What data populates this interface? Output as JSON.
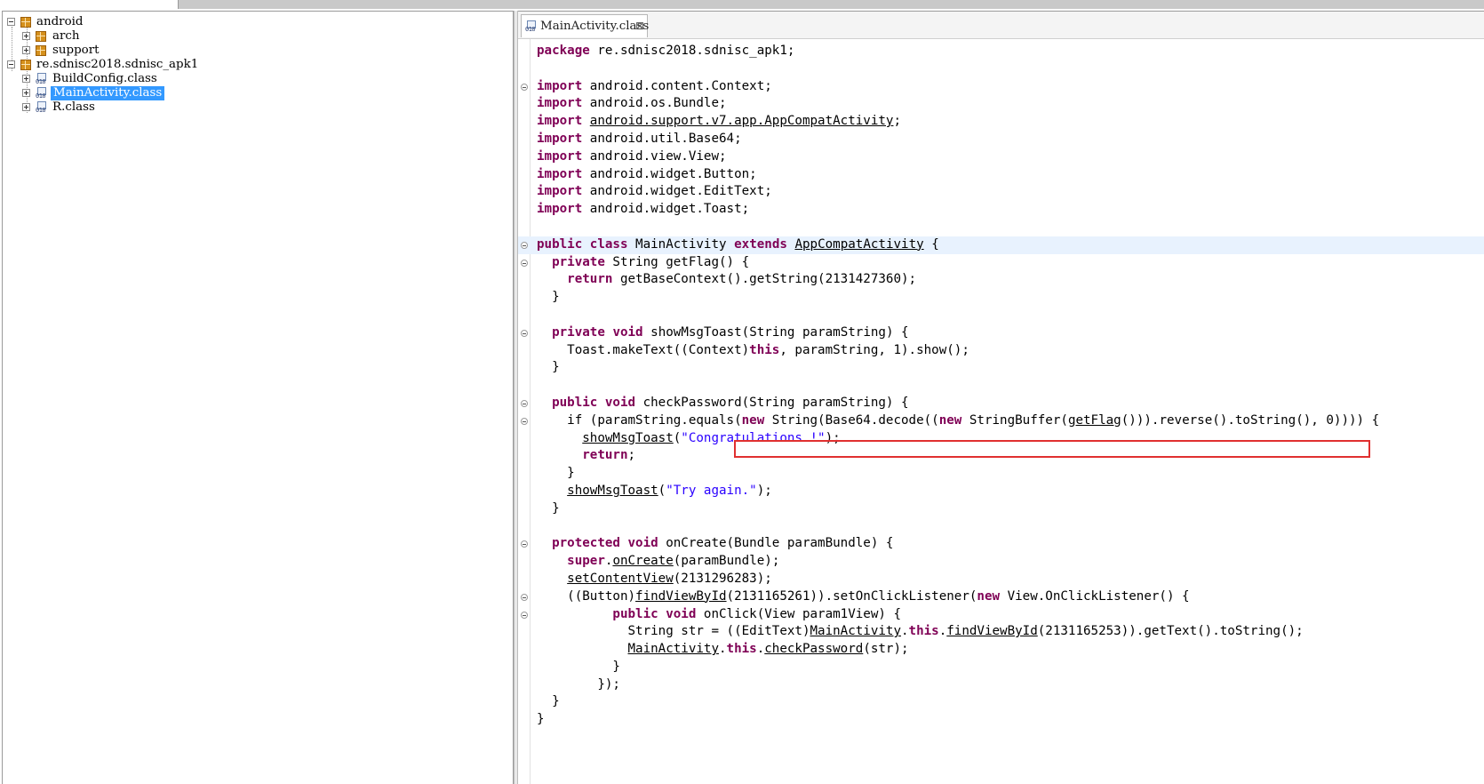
{
  "tree": {
    "items": [
      {
        "label": "android",
        "icon": "package-icon",
        "expanded": true
      },
      {
        "label": "arch",
        "icon": "package-icon",
        "expanded": false
      },
      {
        "label": "support",
        "icon": "package-icon",
        "expanded": false
      },
      {
        "label": "re.sdnisc2018.sdnisc_apk1",
        "icon": "package-icon",
        "expanded": true
      },
      {
        "label": "BuildConfig.class",
        "icon": "class-file-icon",
        "expanded": false
      },
      {
        "label": "MainActivity.class",
        "icon": "class-file-icon",
        "expanded": false,
        "selected": true
      },
      {
        "label": "R.class",
        "icon": "class-file-icon",
        "expanded": false
      }
    ]
  },
  "editor": {
    "tab_label": "MainActivity.class",
    "tab_close": "⊠",
    "highlight_color": "#e03030",
    "code": {
      "l1": [
        "package",
        " re.sdnisc2018.sdnisc_apk1;"
      ],
      "imports": [
        [
          "import",
          " android.content.Context;"
        ],
        [
          "import",
          " android.os.Bundle;"
        ],
        [
          "import",
          " ",
          "android.support.v7.app.AppCompatActivity",
          ";"
        ],
        [
          "import",
          " android.util.Base64;"
        ],
        [
          "import",
          " android.view.View;"
        ],
        [
          "import",
          " android.widget.Button;"
        ],
        [
          "import",
          " android.widget.EditText;"
        ],
        [
          "import",
          " android.widget.Toast;"
        ]
      ],
      "class_decl": [
        "public",
        " ",
        "class",
        " MainActivity ",
        "extends",
        " ",
        "AppCompatActivity",
        " {"
      ],
      "getflag_decl": [
        "  ",
        "private",
        " String getFlag() {"
      ],
      "getflag_return": [
        "    ",
        "return",
        " getBaseContext().getString(2131427360);"
      ],
      "close2": "  }",
      "toast_decl": [
        "  ",
        "private",
        " ",
        "void",
        " showMsgToast(String paramString) {"
      ],
      "toast_body": [
        "    Toast.makeText((Context)",
        "this",
        ", paramString, 1).show();"
      ],
      "check_decl": [
        "  ",
        "public",
        " ",
        "void",
        " checkPassword(String paramString) {"
      ],
      "check_if": [
        "    if (paramString.equals(",
        "new",
        " String(Base64.decode((",
        "new",
        " StringBuffer(",
        "getFlag",
        "())).reverse().toString(), 0)))) {"
      ],
      "congrats": [
        "      ",
        "showMsgToast",
        "(",
        "\"Congratulations !\"",
        ");"
      ],
      "ret": [
        "      ",
        "return",
        ";"
      ],
      "close4": "    }",
      "try_again": [
        "    ",
        "showMsgToast",
        "(",
        "\"Try again.\"",
        ");"
      ],
      "oncreate_decl": [
        "  ",
        "protected",
        " ",
        "void",
        " onCreate(Bundle paramBundle) {"
      ],
      "super_call": [
        "    ",
        "super",
        ".",
        "onCreate",
        "(paramBundle);"
      ],
      "set_content": [
        "    ",
        "setContentView",
        "(2131296283);"
      ],
      "find_view": [
        "    ((Button)",
        "findViewById",
        "(2131165261)).setOnClickListener(",
        "new",
        " View.OnClickListener() {"
      ],
      "onclick_decl": [
        "          ",
        "public",
        " ",
        "void",
        " onClick(View param1View) {"
      ],
      "str_line": [
        "            String str = ((EditText)",
        "MainActivity",
        ".",
        "this",
        ".",
        "findViewById",
        "(2131165253)).getText().toString();"
      ],
      "check_call": [
        "            ",
        "MainActivity",
        ".",
        "this",
        ".",
        "checkPassword",
        "(str);"
      ],
      "close_inner": "          }",
      "close_anon": "        });",
      "close_class": "}"
    }
  }
}
